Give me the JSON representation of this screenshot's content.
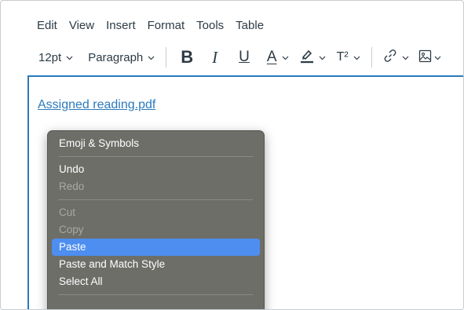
{
  "menubar": {
    "items": [
      "Edit",
      "View",
      "Insert",
      "Format",
      "Tools",
      "Table"
    ]
  },
  "toolbar": {
    "font_size": "12pt",
    "block_format": "Paragraph",
    "bold_label": "B",
    "italic_label": "I",
    "underline_label": "U",
    "text_color_label": "A",
    "superscript_label": "T²"
  },
  "editor": {
    "link_text": "Assigned reading.pdf"
  },
  "context_menu": {
    "items": [
      {
        "label": "Emoji & Symbols",
        "enabled": true
      },
      {
        "label": "Undo",
        "enabled": true
      },
      {
        "label": "Redo",
        "enabled": false
      },
      {
        "label": "Cut",
        "enabled": false
      },
      {
        "label": "Copy",
        "enabled": false
      },
      {
        "label": "Paste",
        "enabled": true,
        "highlighted": true
      },
      {
        "label": "Paste and Match Style",
        "enabled": true
      },
      {
        "label": "Select All",
        "enabled": true
      }
    ]
  },
  "colors": {
    "accent": "#2b7abc",
    "menu_bg": "#6e6e69",
    "menu_highlight": "#4d8ef0"
  }
}
